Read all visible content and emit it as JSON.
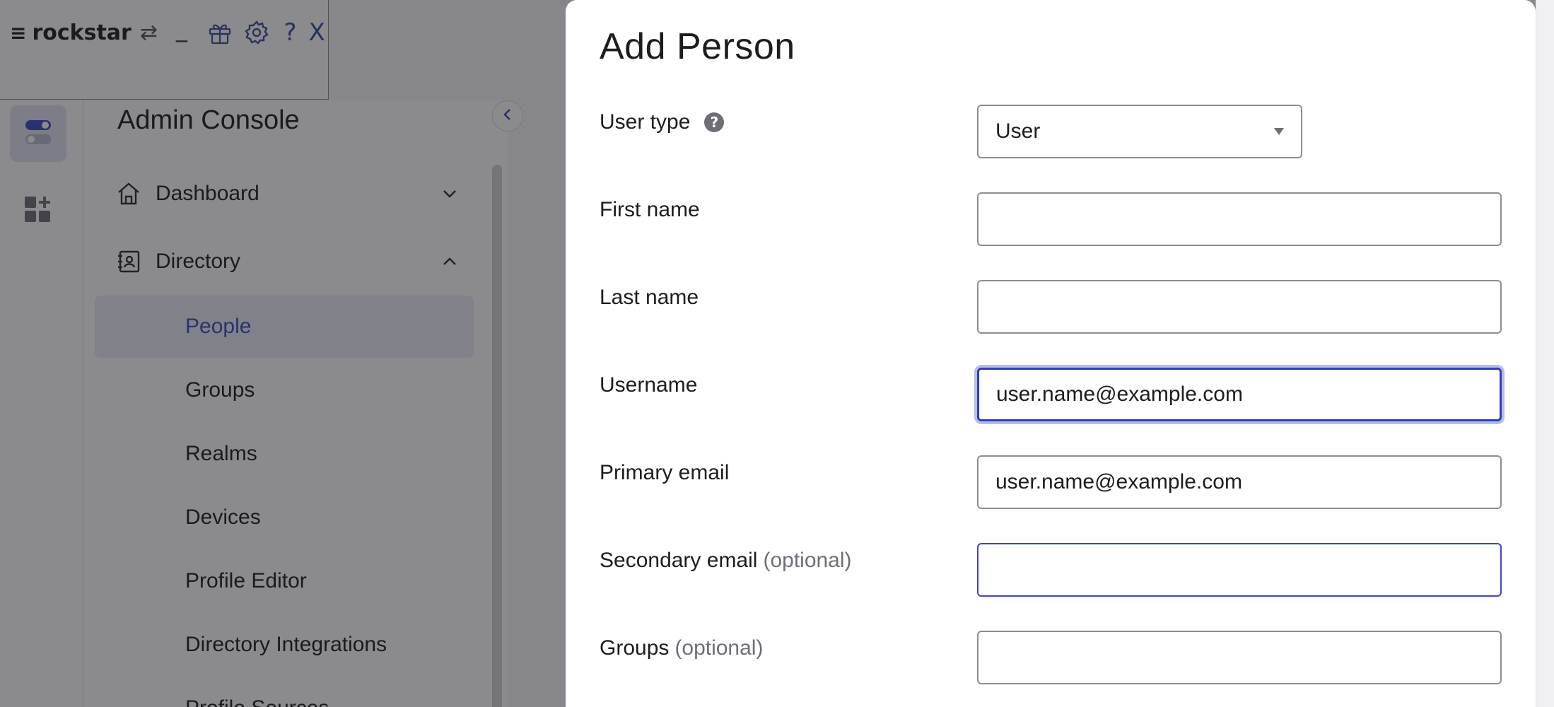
{
  "toolbar": {
    "brand": "rockstar",
    "menu_glyph": "≡",
    "swap_glyph": "⇄",
    "minimize_glyph": "_",
    "help_glyph": "?",
    "close_glyph": "X",
    "icons": [
      "menu-icon",
      "swap-icon",
      "minimize-icon",
      "gift-icon",
      "gear-icon",
      "help-icon",
      "close-icon"
    ]
  },
  "sidebar": {
    "title": "Admin Console",
    "sections": [
      {
        "label": "Dashboard",
        "icon": "home-icon",
        "expanded": false
      },
      {
        "label": "Directory",
        "icon": "directory-icon",
        "expanded": true
      }
    ],
    "items": [
      {
        "label": "People",
        "active": true
      },
      {
        "label": "Groups",
        "active": false
      },
      {
        "label": "Realms",
        "active": false
      },
      {
        "label": "Devices",
        "active": false
      },
      {
        "label": "Profile Editor",
        "active": false
      },
      {
        "label": "Directory Integrations",
        "active": false
      },
      {
        "label": "Profile Sources",
        "active": false
      }
    ]
  },
  "modal": {
    "title": "Add Person",
    "fields": {
      "user_type": {
        "label": "User type",
        "value": "User"
      },
      "first_name": {
        "label": "First name",
        "value": ""
      },
      "last_name": {
        "label": "Last name",
        "value": ""
      },
      "username": {
        "label": "Username",
        "value": "user.name@example.com"
      },
      "primary_email": {
        "label": "Primary email",
        "value": "user.name@example.com"
      },
      "secondary_email": {
        "label": "Secondary email",
        "optional": "(optional)",
        "value": ""
      },
      "groups": {
        "label": "Groups",
        "optional": "(optional)",
        "value": ""
      }
    }
  },
  "colors": {
    "accent": "#3b4cc0",
    "focus_ring": "#b8bdf0",
    "overlay": "#18181e",
    "muted_text": "#6e6e78"
  }
}
